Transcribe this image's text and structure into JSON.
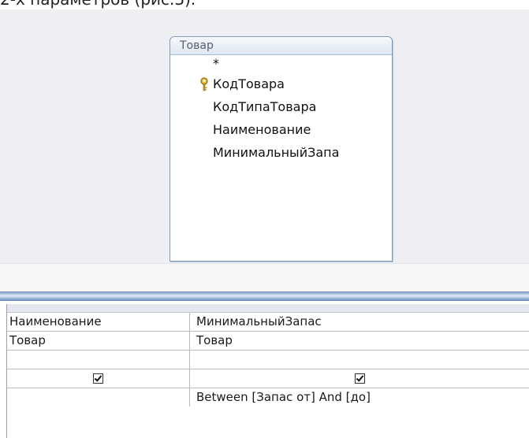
{
  "caption": "2-х параметров (рис.3).",
  "table": {
    "title": "Товар",
    "fields": [
      {
        "label": "*",
        "key": false
      },
      {
        "label": "КодТовара",
        "key": true
      },
      {
        "label": "КодТипаТовара",
        "key": false
      },
      {
        "label": "Наименование",
        "key": false
      },
      {
        "label": "МинимальныйЗапа",
        "key": false
      }
    ],
    "key_icon": "key-icon"
  },
  "grid": {
    "rows": [
      {
        "name": "field",
        "col1": "Наименование",
        "col2": "МинимальныйЗапас"
      },
      {
        "name": "table",
        "col1": "Товар",
        "col2": "Товар"
      },
      {
        "name": "sort",
        "col1": "",
        "col2": ""
      },
      {
        "name": "show",
        "col1_checked": true,
        "col2_checked": true
      },
      {
        "name": "criteria",
        "col1": "",
        "col2": "Between [Запас от] And [до]"
      }
    ]
  }
}
